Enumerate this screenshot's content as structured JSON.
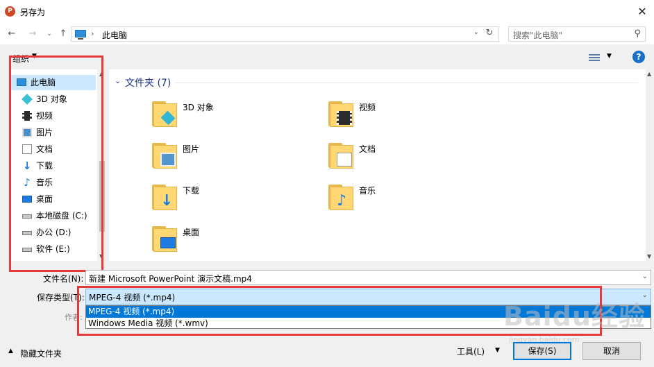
{
  "window": {
    "title": "另存为",
    "app_icon_letter": "P"
  },
  "nav": {
    "breadcrumb": "此电脑",
    "search_placeholder": "搜索\"此电脑\""
  },
  "toolbar": {
    "organize_label": "组织",
    "help_label": "?"
  },
  "sidebar": {
    "items": [
      {
        "label": "此电脑",
        "icon": "pc-icon"
      },
      {
        "label": "3D 对象",
        "icon": "3d-objects-icon"
      },
      {
        "label": "视频",
        "icon": "video-icon"
      },
      {
        "label": "图片",
        "icon": "pictures-icon"
      },
      {
        "label": "文档",
        "icon": "documents-icon"
      },
      {
        "label": "下载",
        "icon": "downloads-icon"
      },
      {
        "label": "音乐",
        "icon": "music-icon"
      },
      {
        "label": "桌面",
        "icon": "desktop-icon"
      },
      {
        "label": "本地磁盘 (C:)",
        "icon": "drive-icon"
      },
      {
        "label": "办公 (D:)",
        "icon": "drive-icon"
      },
      {
        "label": "软件 (E:)",
        "icon": "drive-icon"
      }
    ]
  },
  "content": {
    "group_title": "文件夹 (7)",
    "folders": [
      {
        "label": "3D 对象",
        "icon": "3d-objects-folder-icon"
      },
      {
        "label": "视频",
        "icon": "video-folder-icon"
      },
      {
        "label": "图片",
        "icon": "pictures-folder-icon"
      },
      {
        "label": "文档",
        "icon": "documents-folder-icon"
      },
      {
        "label": "下载",
        "icon": "downloads-folder-icon"
      },
      {
        "label": "音乐",
        "icon": "music-folder-icon"
      },
      {
        "label": "桌面",
        "icon": "desktop-folder-icon"
      }
    ]
  },
  "form": {
    "filename_label": "文件名(N):",
    "filename_value": "新建 Microsoft PowerPoint 演示文稿.mp4",
    "type_label": "保存类型(T):",
    "type_value": "MPEG-4 视频 (*.mp4)",
    "type_options": [
      "MPEG-4 视频 (*.mp4)",
      "Windows Media 视频 (*.wmv)"
    ],
    "author_label": "作者:"
  },
  "footer": {
    "hide_folders_label": "隐藏文件夹",
    "tools_label": "工具(L)",
    "save_label": "保存(S)",
    "cancel_label": "取消"
  },
  "watermark": {
    "text": "Baidu经验",
    "sub": "jingyan.baidu.com"
  },
  "colors": {
    "highlight": "#e53a3a",
    "selection": "#0078d7",
    "folder": "#ffd874"
  }
}
